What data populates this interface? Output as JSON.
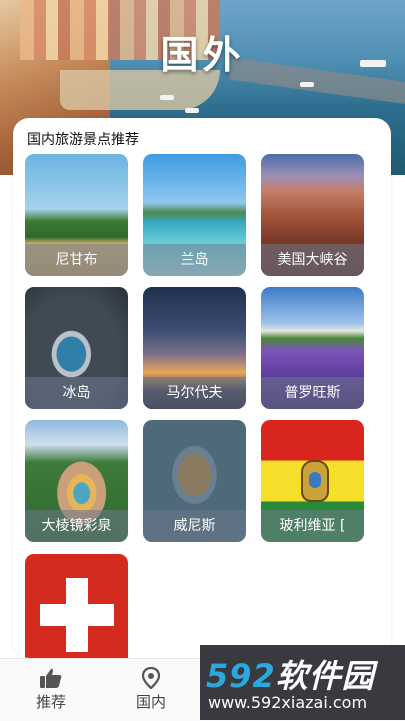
{
  "hero": {
    "title": "国外"
  },
  "section": {
    "title": "国内旅游景点推荐"
  },
  "destinations": [
    {
      "label": "尼甘布"
    },
    {
      "label": "兰岛"
    },
    {
      "label": "美国大峡谷"
    },
    {
      "label": "冰岛"
    },
    {
      "label": "马尔代夫"
    },
    {
      "label": "普罗旺斯"
    },
    {
      "label": "大棱镜彩泉"
    },
    {
      "label": "威尼斯"
    },
    {
      "label": "玻利维亚 ["
    },
    {
      "label": ""
    }
  ],
  "bottom_nav": {
    "items": [
      {
        "label": "推荐",
        "icon": "thumbs-up-icon"
      },
      {
        "label": "国内",
        "icon": "location-pin-icon"
      }
    ]
  },
  "watermark": {
    "logo_number": "592",
    "logo_text": "软件园",
    "url": "www.592xiazai.com"
  },
  "colors": {
    "accent_blue": "#2aa9e0",
    "label_overlay": "#6e788c",
    "swiss_red": "#d52b1e"
  }
}
